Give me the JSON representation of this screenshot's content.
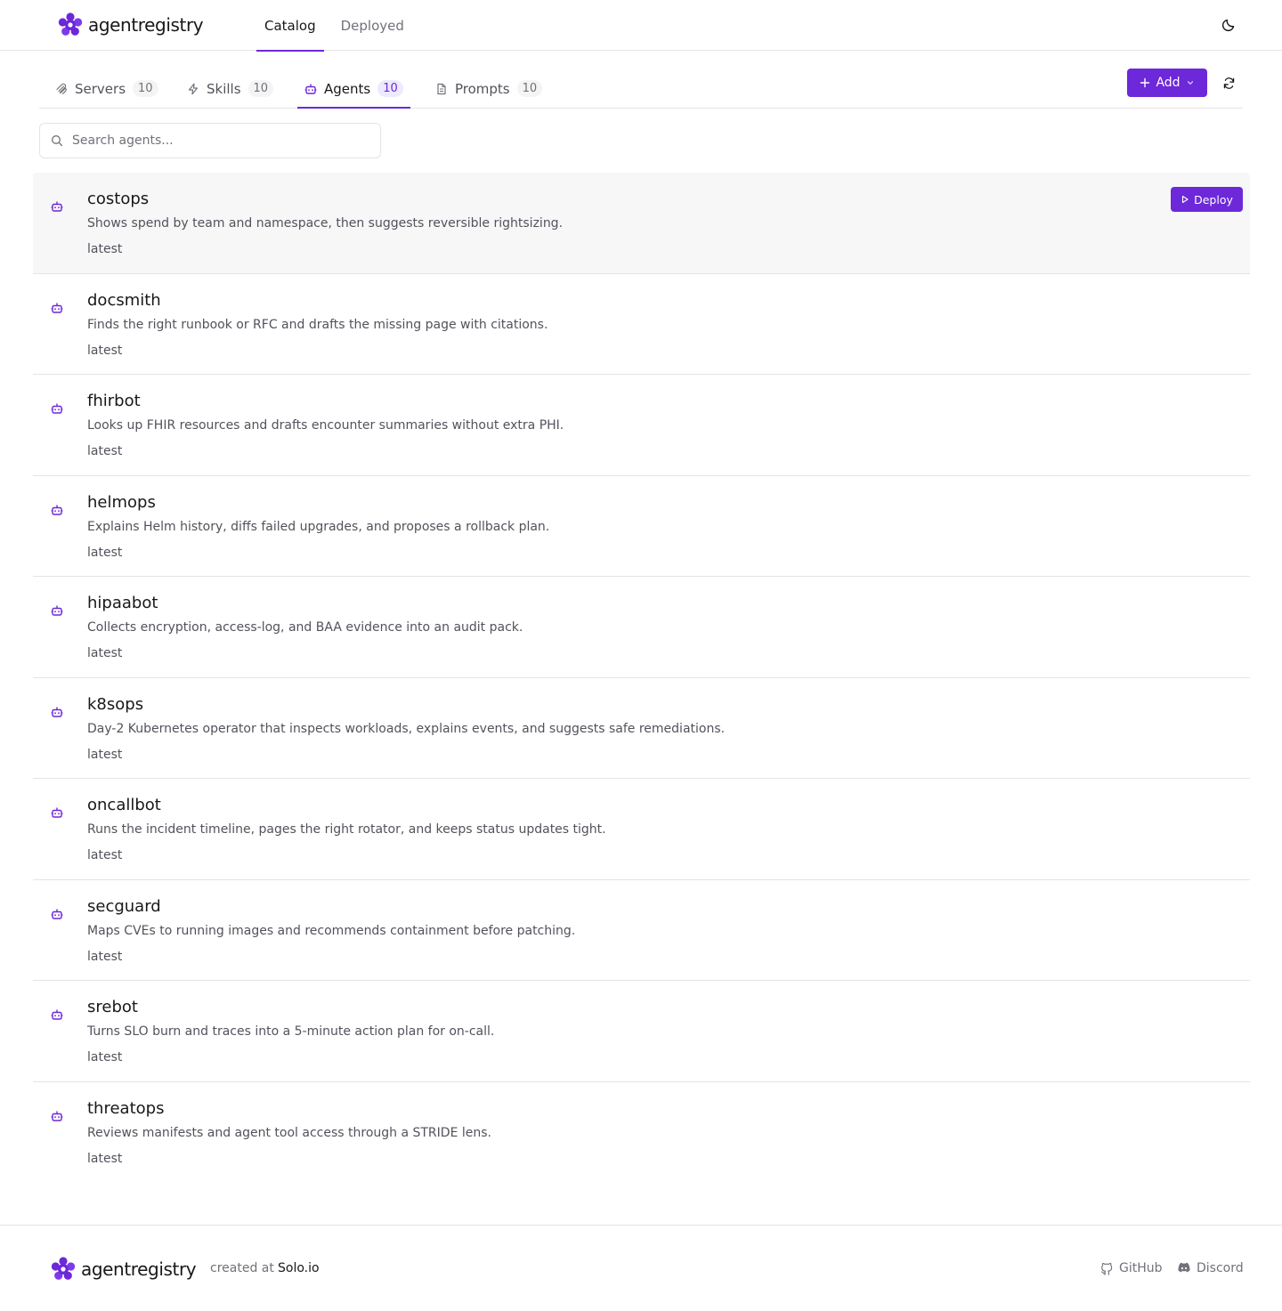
{
  "app": {
    "name": "agentregistry"
  },
  "colors": {
    "accent": "#6d28d9",
    "accent_soft": "#ede9fe"
  },
  "top_nav": [
    {
      "label": "Catalog",
      "active": true
    },
    {
      "label": "Deployed",
      "active": false
    }
  ],
  "tabs": [
    {
      "label": "Servers",
      "count": "10",
      "icon": "server-icon"
    },
    {
      "label": "Skills",
      "count": "10",
      "icon": "lightning-icon"
    },
    {
      "label": "Agents",
      "count": "10",
      "icon": "bot-icon",
      "active": true
    },
    {
      "label": "Prompts",
      "count": "10",
      "icon": "document-icon"
    }
  ],
  "toolbar": {
    "add_label": "Add"
  },
  "search": {
    "placeholder": "Search agents..."
  },
  "agents": [
    {
      "name": "costops",
      "description": "Shows spend by team and namespace, then suggests reversible rightsizing.",
      "version": "latest",
      "deploy_label": "Deploy"
    },
    {
      "name": "docsmith",
      "description": "Finds the right runbook or RFC and drafts the missing page with citations.",
      "version": "latest"
    },
    {
      "name": "fhirbot",
      "description": "Looks up FHIR resources and drafts encounter summaries without extra PHI.",
      "version": "latest"
    },
    {
      "name": "helmops",
      "description": "Explains Helm history, diffs failed upgrades, and proposes a rollback plan.",
      "version": "latest"
    },
    {
      "name": "hipaabot",
      "description": "Collects encryption, access-log, and BAA evidence into an audit pack.",
      "version": "latest"
    },
    {
      "name": "k8sops",
      "description": "Day-2 Kubernetes operator that inspects workloads, explains events, and suggests safe remediations.",
      "version": "latest"
    },
    {
      "name": "oncallbot",
      "description": "Runs the incident timeline, pages the right rotator, and keeps status updates tight.",
      "version": "latest"
    },
    {
      "name": "secguard",
      "description": "Maps CVEs to running images and recommends containment before patching.",
      "version": "latest"
    },
    {
      "name": "srebot",
      "description": "Turns SLO burn and traces into a 5-minute action plan for on-call.",
      "version": "latest"
    },
    {
      "name": "threatops",
      "description": "Reviews manifests and agent tool access through a STRIDE lens.",
      "version": "latest"
    }
  ],
  "footer": {
    "created_text": "created at",
    "created_link": "Solo.io",
    "github_label": "GitHub",
    "discord_label": "Discord"
  }
}
